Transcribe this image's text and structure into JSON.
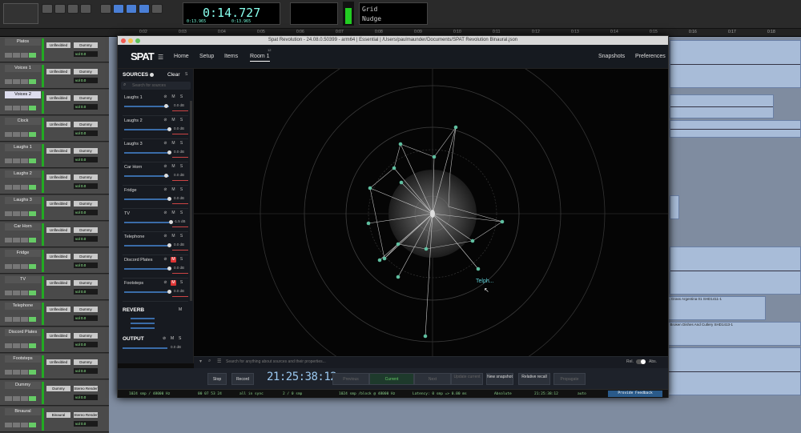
{
  "pt": {
    "main_counter": "0:14.727",
    "counter_small": "0:13.965",
    "counter_small2": "0:13.965",
    "grid_label": "Grid",
    "nudge_label": "Nudge",
    "ruler": [
      "0:02",
      "0:03",
      "0:04",
      "0:05",
      "0:06",
      "0:07",
      "0:08",
      "0:09",
      "0:10",
      "0:11",
      "0:12",
      "0:13",
      "0:14",
      "0:15",
      "0:16",
      "0:17",
      "0:18"
    ]
  },
  "tracks": [
    {
      "name": "Platos",
      "s1": "Unflexibled",
      "s2": "Dummy",
      "vol": "vol 0.0"
    },
    {
      "name": "Voices 1",
      "s1": "Unflexibled",
      "s2": "Dummy",
      "vol": "vol 0.0"
    },
    {
      "name": "Voices 2",
      "s1": "Unflexibled",
      "s2": "Dummy",
      "vol": "vol 0.0",
      "sel": true
    },
    {
      "name": "Clock",
      "s1": "Unflexibled",
      "s2": "Dummy",
      "vol": "vol 0.0"
    },
    {
      "name": "Laughs 1",
      "s1": "Unflexibled",
      "s2": "Dummy",
      "vol": "vol 0.0"
    },
    {
      "name": "Laughs 2",
      "s1": "Unflexibled",
      "s2": "Dummy",
      "vol": "vol 0.0"
    },
    {
      "name": "Laughs 3",
      "s1": "Unflexibled",
      "s2": "Dummy",
      "vol": "vol 0.0"
    },
    {
      "name": "Car Horn",
      "s1": "Unflexibled",
      "s2": "Dummy",
      "vol": "vol 0.0"
    },
    {
      "name": "Fridge",
      "s1": "Unflexibled",
      "s2": "Dummy",
      "vol": "vol 0.0"
    },
    {
      "name": "TV",
      "s1": "Unflexibled",
      "s2": "Dummy",
      "vol": "vol 0.0"
    },
    {
      "name": "Telephone",
      "s1": "Unflexibled",
      "s2": "Dummy",
      "vol": "vol 0.0"
    },
    {
      "name": "Discord Plates",
      "s1": "Unflexibled",
      "s2": "Dummy",
      "vol": "vol 0.0"
    },
    {
      "name": "Footsteps",
      "s1": "Unflexibled",
      "s2": "Dummy",
      "vol": "vol 0.0"
    },
    {
      "name": "Dummy",
      "s1": "Dummy",
      "s2": "Stereo Render",
      "vol": "vol 0.0"
    },
    {
      "name": "Binaural",
      "s1": "Binaural",
      "s2": "Stereo Render",
      "vol": "vol 0.0"
    }
  ],
  "clip_labels": {
    "c1": "Ext. Grass Argentina 01 SHD1411-1",
    "c2": "Int. Broken Dishes And Cutlery SHD1413-1"
  },
  "spat": {
    "window_title": "Spat Revolution - 24.08.0.50399 - arm64 | Essential | /Users/paulmaunder/Documents/SPAT Revolution Binaural.json",
    "logo": "SPAT",
    "nav": {
      "home": "Home",
      "setup": "Setup",
      "items": "Items",
      "room": "Room 1",
      "room_badge": "12",
      "snapshots": "Snapshots",
      "preferences": "Preferences"
    },
    "sources_header": "SOURCES",
    "clear_label": "Clear",
    "clear_count": "S",
    "search_placeholder": "Search for sources",
    "sources": [
      {
        "name": "Laughs 1",
        "val": "0.0 dB"
      },
      {
        "name": "Laughs 2",
        "val": "0.0 dB"
      },
      {
        "name": "Laughs 3",
        "val": "0.0 dB"
      },
      {
        "name": "Car Horn",
        "val": "0.0 dB"
      },
      {
        "name": "Fridge",
        "val": "0.0 dB"
      },
      {
        "name": "TV",
        "val": "-1.5 dB"
      },
      {
        "name": "Telephone",
        "val": "0.0 dB"
      },
      {
        "name": "Discord Plates",
        "val": "0.0 dB",
        "muted": true
      },
      {
        "name": "Footsteps",
        "val": "0.0 dB",
        "muted": true
      }
    ],
    "reverb_header": "REVERB",
    "output_header": "OUTPUT",
    "output_val": "0.0 dB",
    "tooltip_source": "Telph...",
    "bottom_search_placeholder": "Search for anything about sources and their properties...",
    "rel_label": "Rel.",
    "abs_label": "Abs.",
    "transport": {
      "stop": "Stop",
      "record": "Record",
      "clock": "21:25:38:12",
      "previous": "Previous",
      "current": "Current",
      "next": "Next",
      "update_current": "Update current",
      "new_snapshot": "New snapshot",
      "relative_recall": "Relative recall",
      "propagate": "Propagate"
    },
    "status": {
      "input_stream": "1024 smp / 48000 Hz",
      "time": "00 07 53 24",
      "sync": "all in sync",
      "page": "2 / 0 smp",
      "latency": "1024 smp /block @ 48000 Hz",
      "lat2": "Latency: 0 smp => 0.00 ms",
      "mode": "Absolute",
      "tc": "21:25:38:12",
      "auto": "auto",
      "feedback": "Provide Feedback"
    }
  }
}
